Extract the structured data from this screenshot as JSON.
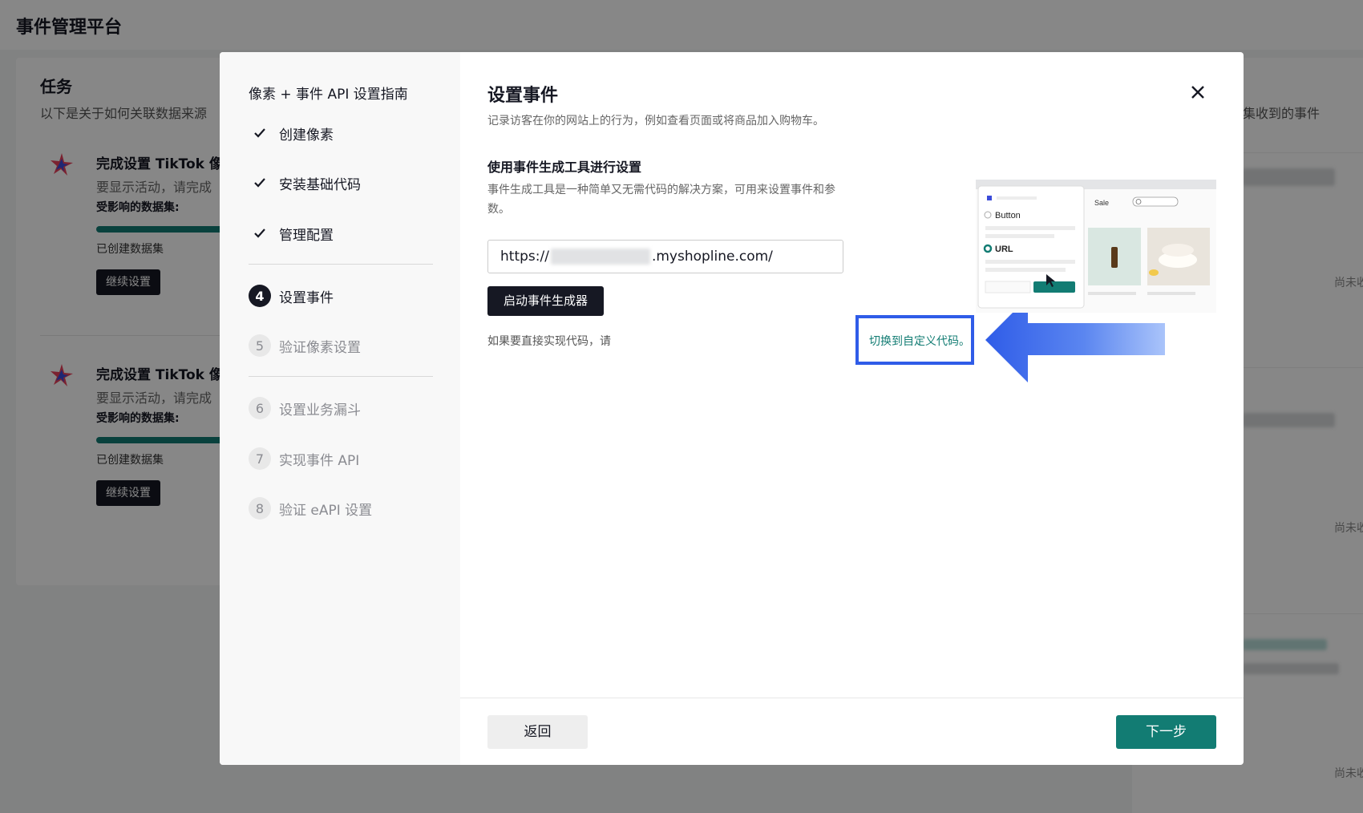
{
  "page": {
    "title": "事件管理平台"
  },
  "tasks": {
    "title": "任务",
    "subtitle": "以下是关于如何关联数据来源",
    "items": [
      {
        "title": "完成设置 TikTok 像素",
        "desc": "要显示活动，请完成",
        "dataset_label": "受影响的数据集:",
        "status": "已创建数据集",
        "button": "继续设置"
      },
      {
        "title": "完成设置 TikTok 像素",
        "desc": "要显示活动，请完成",
        "dataset_label": "受影响的数据集:",
        "status": "已创建数据集",
        "button": "继续设置"
      }
    ]
  },
  "right_panel": {
    "label": "集收到的事件",
    "notes": [
      "尚未收",
      "尚未收",
      "尚未收"
    ]
  },
  "modal": {
    "sidebar": {
      "title": "像素 + 事件 API 设置指南",
      "steps": [
        {
          "label": "创建像素",
          "state": "done"
        },
        {
          "label": "安装基础代码",
          "state": "done"
        },
        {
          "label": "管理配置",
          "state": "done"
        },
        {
          "num": "4",
          "label": "设置事件",
          "state": "current"
        },
        {
          "num": "5",
          "label": "验证像素设置",
          "state": "todo"
        },
        {
          "num": "6",
          "label": "设置业务漏斗",
          "state": "todo"
        },
        {
          "num": "7",
          "label": "实现事件 API",
          "state": "todo"
        },
        {
          "num": "8",
          "label": "验证 eAPI 设置",
          "state": "todo"
        }
      ]
    },
    "title": "设置事件",
    "subtitle": "记录访客在你的网站上的行为，例如查看页面或将商品加入购物车。",
    "section_title": "使用事件生成工具进行设置",
    "section_desc": "事件生成工具是一种简单又无需代码的解决方案，可用来设置事件和参数。",
    "url_prefix": "https://",
    "url_suffix": ".myshopline.com/",
    "launch_button": "启动事件生成器",
    "custom_text": "如果要直接实现代码，请",
    "custom_link": "切换到自定义代码。",
    "preview": {
      "sale": "Sale",
      "option_button": "Button",
      "option_url": "URL"
    },
    "back_button": "返回",
    "next_button": "下一步"
  },
  "colors": {
    "accent": "#127c73",
    "highlight": "#2f5ce8",
    "dark": "#161823"
  }
}
